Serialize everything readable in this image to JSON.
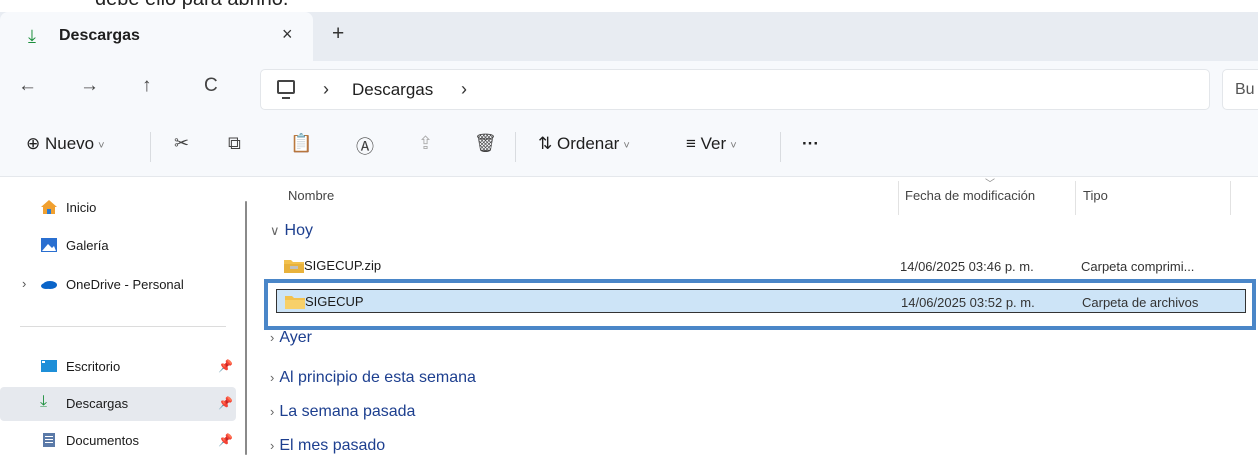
{
  "caption": {
    "text": "debe ello para abrirlo."
  },
  "tab": {
    "label": "Descargas",
    "close": "×",
    "new_tab": "+"
  },
  "nav": {
    "back": "←",
    "forward": "→",
    "up": "↑",
    "refresh": "C"
  },
  "address": {
    "separator": "›",
    "path": "Descargas",
    "search_placeholder": "Bu"
  },
  "toolbar": {
    "new_label": "Nuevo",
    "sort_label": "Ordenar",
    "view_label": "Ver",
    "more_label": "···"
  },
  "sidebar": {
    "items": [
      {
        "label": "Inicio"
      },
      {
        "label": "Galería"
      },
      {
        "label": "OneDrive - Personal"
      },
      {
        "label": "Escritorio"
      },
      {
        "label": "Descargas"
      },
      {
        "label": "Documentos"
      }
    ]
  },
  "columns": {
    "name": "Nombre",
    "date": "Fecha de modificación",
    "type": "Tipo"
  },
  "groups": {
    "today": "Hoy",
    "yesterday": "Ayer",
    "this_week": "Al principio de esta semana",
    "last_week": "La semana pasada",
    "last_month": "El mes pasado"
  },
  "files": [
    {
      "name": "SIGECUP.zip",
      "date": "14/06/2025 03:46 p. m.",
      "type": "Carpeta comprimi..."
    },
    {
      "name": "SIGECUP",
      "date": "14/06/2025 03:52 p. m.",
      "type": "Carpeta de archivos"
    }
  ],
  "colors": {
    "accent": "#4a86c8",
    "selection": "#cde4f7",
    "group_text": "#1d3f8f",
    "folder": "#f2c14e"
  }
}
